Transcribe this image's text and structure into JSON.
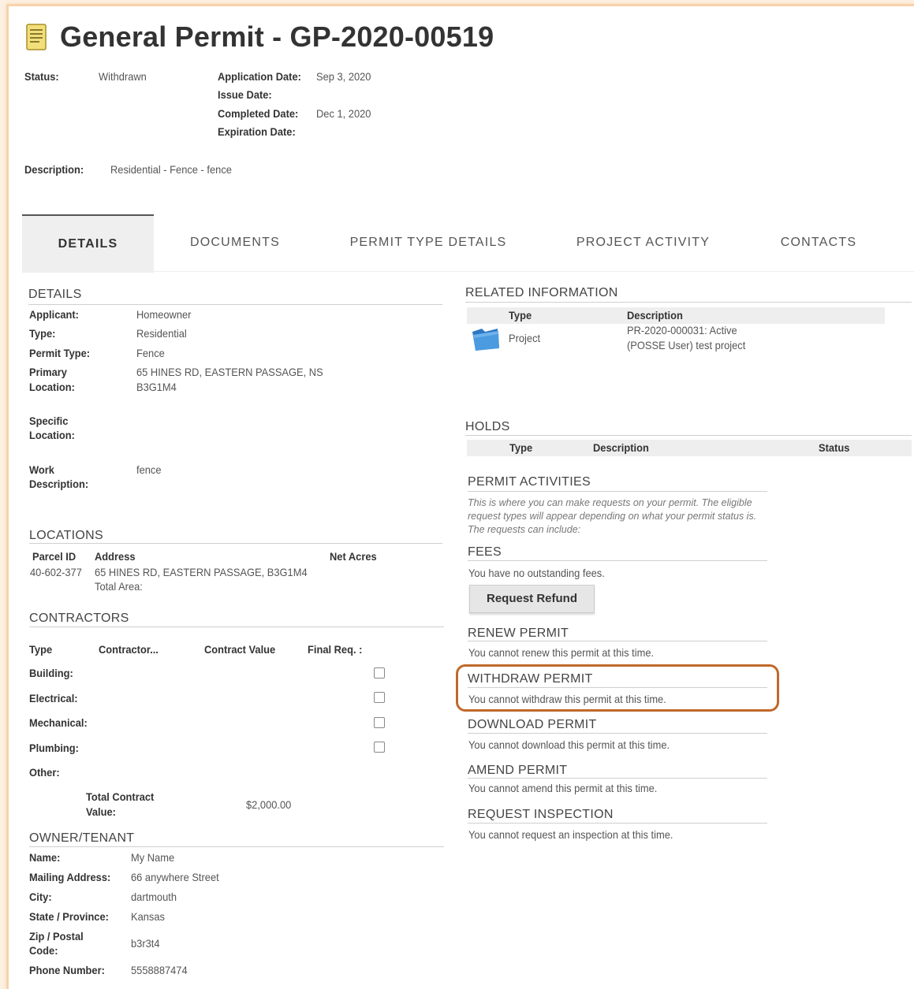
{
  "header": {
    "title": "General Permit - GP-2020-00519",
    "status_label": "Status:",
    "status_value": "Withdrawn",
    "application_date_label": "Application Date:",
    "application_date_value": "Sep 3, 2020",
    "issue_date_label": "Issue Date:",
    "completed_date_label": "Completed Date:",
    "completed_date_value": "Dec 1, 2020",
    "expiration_date_label": "Expiration Date:",
    "description_label": "Description:",
    "description_value": "Residential - Fence - fence"
  },
  "tabs": [
    "DETAILS",
    "DOCUMENTS",
    "PERMIT TYPE DETAILS",
    "PROJECT ACTIVITY",
    "CONTACTS"
  ],
  "details": {
    "heading": "DETAILS",
    "applicant_label": "Applicant:",
    "applicant_value": "Homeowner",
    "type_label": "Type:",
    "type_value": "Residential",
    "permit_type_label": "Permit Type:",
    "permit_type_value": "Fence",
    "primary_location_label_1": "Primary",
    "primary_location_label_2": "Location:",
    "primary_location_value_1": "65 HINES RD, EASTERN PASSAGE, NS",
    "primary_location_value_2": "B3G1M4",
    "specific_location_label_1": "Specific",
    "specific_location_label_2": "Location:",
    "work_description_label_1": "Work",
    "work_description_label_2": "Description:",
    "work_description_value": "fence"
  },
  "locations": {
    "heading": "LOCATIONS",
    "col_parcel": "Parcel ID",
    "col_address": "Address",
    "col_net_acres": "Net Acres",
    "parcel_id": "40-602-377",
    "address": "65 HINES RD, EASTERN PASSAGE, B3G1M4",
    "total_area_label": "Total Area:"
  },
  "contractors": {
    "heading": "CONTRACTORS",
    "col_type": "Type",
    "col_contractor": "Contractor...",
    "col_contract_value": "Contract Value",
    "col_final_req": "Final Req. :",
    "rows": [
      "Building:",
      "Electrical:",
      "Mechanical:",
      "Plumbing:",
      "Other:"
    ],
    "total_label_1": "Total Contract",
    "total_label_2": "Value:",
    "total_value": "$2,000.00"
  },
  "owner": {
    "heading": "OWNER/TENANT",
    "name_label": "Name:",
    "name_value": "My Name",
    "mailing_label": "Mailing Address:",
    "mailing_value": "66 anywhere Street",
    "city_label": "City:",
    "city_value": "dartmouth",
    "state_label": "State / Province:",
    "state_value": "Kansas",
    "zip_label_1": "Zip / Postal",
    "zip_label_2": "Code:",
    "zip_value": "b3r3t4",
    "phone_label": "Phone Number:",
    "phone_value": "5558887474"
  },
  "related": {
    "heading": "RELATED INFORMATION",
    "col_type": "Type",
    "col_description": "Description",
    "row_type": "Project",
    "row_description_1": "PR-2020-000031: Active",
    "row_description_2": "(POSSE User) test project"
  },
  "holds": {
    "heading": "HOLDS",
    "col_type": "Type",
    "col_description": "Description",
    "col_status": "Status"
  },
  "activities": {
    "heading": "PERMIT ACTIVITIES",
    "intro": "This is where you can make requests on your permit. The eligible request types will appear depending on what your permit status is. The requests can include:",
    "fees_heading": "FEES",
    "fees_text": "You have no outstanding fees.",
    "refund_button": "Request Refund",
    "renew_heading": "RENEW PERMIT",
    "renew_text": "You cannot renew this permit at this time.",
    "withdraw_heading": "WITHDRAW PERMIT",
    "withdraw_text": "You cannot withdraw this permit at this time.",
    "download_heading": "DOWNLOAD PERMIT",
    "download_text": "You cannot download this permit at this time.",
    "amend_heading": "AMEND PERMIT",
    "amend_text": "You cannot amend this permit at this time.",
    "inspection_heading": "REQUEST INSPECTION",
    "inspection_text": "You cannot request an inspection at this time."
  },
  "colors": {
    "highlight": "#c0692a",
    "page_border": "#f6d3aa"
  },
  "icons": {
    "title_icon": "document-icon",
    "project_icon": "folder-icon"
  }
}
